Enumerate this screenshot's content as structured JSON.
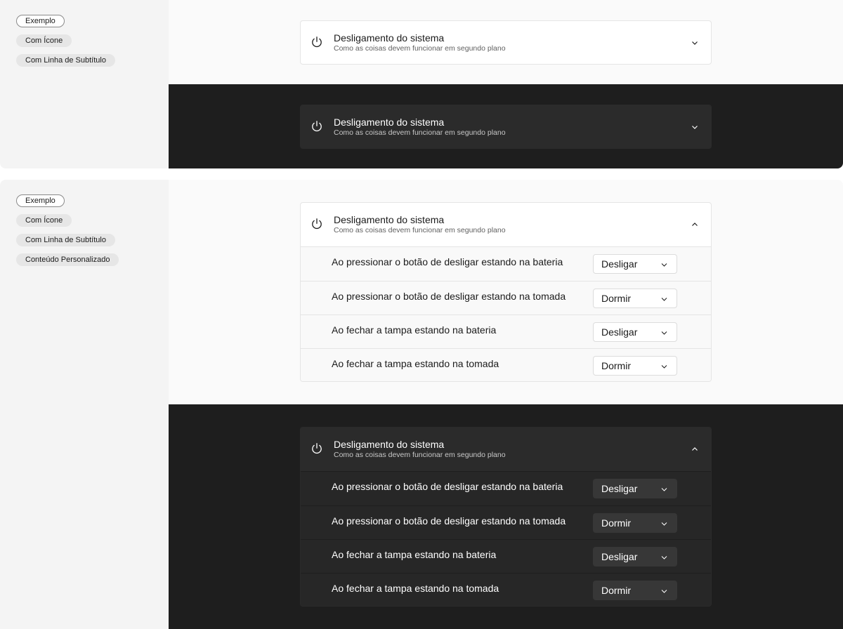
{
  "colors": {
    "sidebar_bg": "#f4f4f4",
    "light_bg": "#fafafa",
    "dark_bg": "#1e1e1e",
    "light_card": "#ffffff",
    "dark_card": "#2b2b2b"
  },
  "section1": {
    "sidebar": {
      "chips": [
        "Exemplo",
        "Com Ícone",
        "Com Linha de Subtítulo"
      ],
      "active_chip": "Exemplo"
    },
    "expander": {
      "icon": "power-icon",
      "title": "Desligamento do sistema",
      "subtitle": "Como as coisas devem funcionar em segundo plano",
      "state": "collapsed",
      "chevron": "chevron-down-icon"
    }
  },
  "section2": {
    "sidebar": {
      "chips": [
        "Exemplo",
        "Com Ícone",
        "Com Linha de Subtítulo",
        "Conteúdo Personalizado"
      ],
      "active_chip": "Exemplo"
    },
    "expander": {
      "icon": "power-icon",
      "title": "Desligamento do sistema",
      "subtitle": "Como as coisas devem funcionar em segundo plano",
      "state": "expanded",
      "chevron": "chevron-up-icon",
      "rows": [
        {
          "label": "Ao pressionar o botão de desligar estando na bateria",
          "value": "Desligar"
        },
        {
          "label": "Ao pressionar o botão de desligar estando na tomada",
          "value": "Dormir"
        },
        {
          "label": "Ao fechar a tampa estando na bateria",
          "value": "Desligar"
        },
        {
          "label": "Ao fechar a tampa estando na tomada",
          "value": "Dormir"
        }
      ]
    }
  }
}
